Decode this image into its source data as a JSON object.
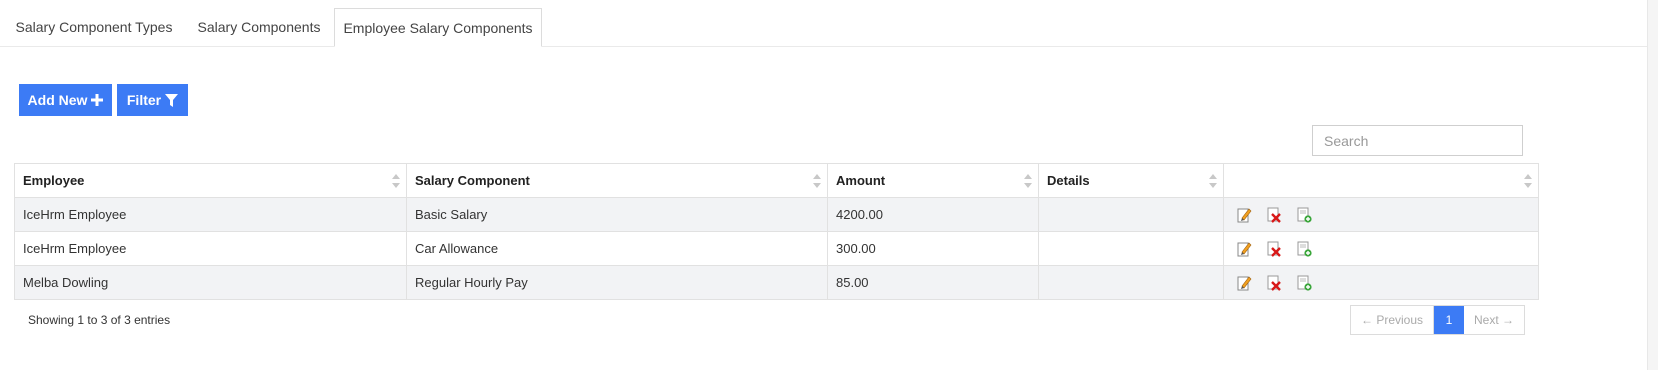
{
  "tabs": [
    {
      "label": "Salary Component Types",
      "active": false
    },
    {
      "label": "Salary Components",
      "active": false
    },
    {
      "label": "Employee Salary Components",
      "active": true
    }
  ],
  "toolbar": {
    "add_label": "Add New",
    "add_icon": "plus-icon",
    "filter_label": "Filter",
    "filter_icon": "funnel-icon",
    "accent_color": "#3c7bf5"
  },
  "search": {
    "placeholder": "Search",
    "value": ""
  },
  "table": {
    "columns": [
      "Employee",
      "Salary Component",
      "Amount",
      "Details",
      ""
    ],
    "rows": [
      {
        "employee": "IceHrm Employee",
        "component": "Basic Salary",
        "amount": "4200.00",
        "details": ""
      },
      {
        "employee": "IceHrm Employee",
        "component": "Car Allowance",
        "amount": "300.00",
        "details": ""
      },
      {
        "employee": "Melba Dowling",
        "component": "Regular Hourly Pay",
        "amount": "85.00",
        "details": ""
      }
    ],
    "row_actions": [
      "edit-icon",
      "delete-icon",
      "copy-icon"
    ]
  },
  "footer": {
    "info": "Showing 1 to 3 of 3 entries",
    "prev_label": "← Previous",
    "page": "1",
    "next_label": "Next →"
  }
}
